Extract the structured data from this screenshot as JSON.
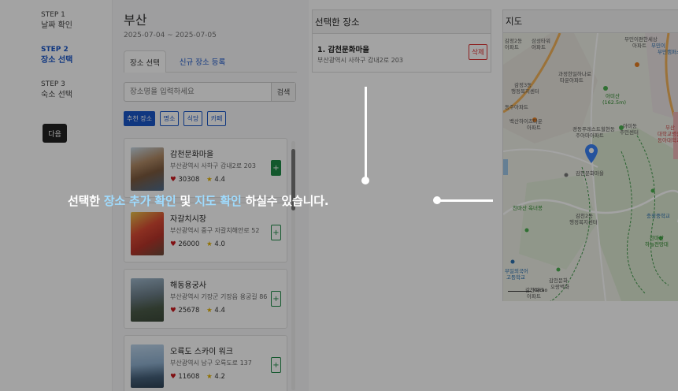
{
  "steps": [
    {
      "no": "STEP 1",
      "label": "날짜 확인"
    },
    {
      "no": "STEP 2",
      "label": "장소 선택"
    },
    {
      "no": "STEP 3",
      "label": "숙소 선택"
    }
  ],
  "next_label": "다음",
  "city": "부산",
  "date_range": "2025-07-04 ~ 2025-07-05",
  "tabs": [
    "장소 선택",
    "신규 장소 등록"
  ],
  "search": {
    "placeholder": "장소명을 입력하세요",
    "button": "검색"
  },
  "filters": [
    "추천 장소",
    "명소",
    "식당",
    "카페"
  ],
  "places": [
    {
      "name": "감천문화마을",
      "address": "부산광역시 사하구 감내2로 203",
      "likes": "30308",
      "rating": "4.4",
      "add": "+"
    },
    {
      "name": "자갈치시장",
      "address": "부산광역시 중구 자갈치해안로 52",
      "likes": "26000",
      "rating": "4.0",
      "add": "+"
    },
    {
      "name": "해동용궁사",
      "address": "부산광역시 기장군 기장읍 용궁길 86",
      "likes": "25678",
      "rating": "4.4",
      "add": "+"
    },
    {
      "name": "오륙도 스카이 워크",
      "address": "부산광역시 남구 오륙도로 137",
      "likes": "11608",
      "rating": "4.2",
      "add": "+"
    }
  ],
  "selected_panel": {
    "title": "선택한 장소",
    "item": {
      "name": "1. 감천문화마을",
      "address": "부산광역시 사하구 감내2로 203"
    },
    "delete_label": "삭제"
  },
  "map_panel": {
    "title": "지도",
    "labels": {
      "l1": "감정2동",
      "l2": "삼성타워",
      "l3": "아파트",
      "l4": "아파트",
      "l5": "부민이편한세상",
      "l6": "아파트",
      "l7": "과정한일하나로",
      "l8": "타운아파트",
      "l9": "감정3동",
      "l10": "행정복지센터",
      "l11": "아미산",
      "l12": "(162.5m)",
      "l13": "동주아파트",
      "l14": "백산하이츠타운",
      "l15": "아파트",
      "l16": "경동푸레스트힐현동",
      "l17": "주아마아파트",
      "l18": "아미동",
      "l19": "주민센터",
      "l20": "부산",
      "l21": "대학교병원",
      "l22": "감천문화마을",
      "l23": "천마산 옥녀봉",
      "l24": "감천2동",
      "l25": "행정복지센터",
      "l26": "천마산",
      "l27": "하늘전망대",
      "l28": "부일외국어",
      "l29": "고등학교",
      "l30": "감천문화",
      "l31": "오랑벽화",
      "l32": "감천파크",
      "l33": "아파트",
      "l34": "부민캠퍼스",
      "l35": "충정중학교",
      "l36": "Kakao",
      "l37": "부민이",
      "l38": "동아대학교"
    }
  },
  "overlay": {
    "t1": "선택한 ",
    "t2": "장소 추가 확인",
    "t3": " 및 ",
    "t4": "지도 확인",
    "t5": " 하실수 있습니다."
  }
}
